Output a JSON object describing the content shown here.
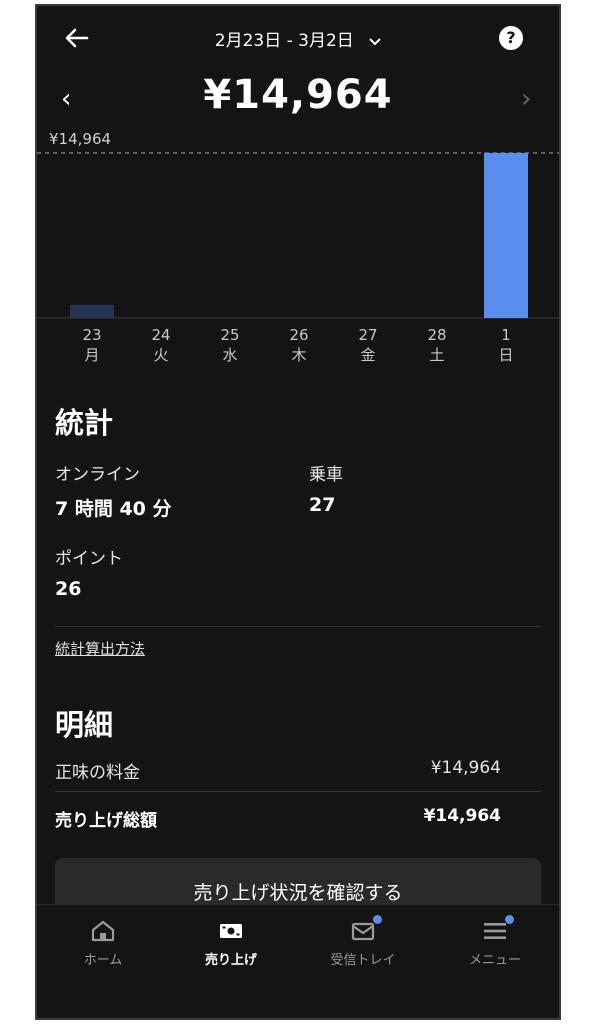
{
  "header": {
    "date_range": "2月23日 - 3月2日",
    "total": "¥14,964"
  },
  "chart_data": {
    "type": "bar",
    "categories": [
      "23 月",
      "24 火",
      "25 水",
      "26 木",
      "27 金",
      "28 土",
      "1 日"
    ],
    "day_numbers": [
      "23",
      "24",
      "25",
      "26",
      "27",
      "28",
      "1"
    ],
    "weekdays": [
      "月",
      "火",
      "水",
      "木",
      "金",
      "土",
      "日"
    ],
    "values": [
      1200,
      0,
      0,
      0,
      0,
      0,
      14964
    ],
    "max_label": "¥14,964",
    "ylim": [
      0,
      14964
    ],
    "colors": {
      "active": "#5b8def",
      "inactive": "#263552",
      "reference_line": "#8a8a8a"
    }
  },
  "stats": {
    "title": "統計",
    "online_label": "オンライン",
    "online_value": "7 時間 40 分",
    "rides_label": "乗車",
    "rides_value": "27",
    "points_label": "ポイント",
    "points_value": "26",
    "method_link": "統計算出方法"
  },
  "details": {
    "title": "明細",
    "net_fare_label": "正味の料金",
    "net_fare_value": "¥14,964",
    "total_sales_label": "売り上げ総額",
    "total_sales_value": "¥14,964",
    "cta_label": "売り上げ状況を確認する"
  },
  "nav": {
    "items": [
      {
        "label": "ホーム",
        "icon": "home-icon"
      },
      {
        "label": "売り上げ",
        "icon": "cash-icon"
      },
      {
        "label": "受信トレイ",
        "icon": "inbox-icon"
      },
      {
        "label": "メニュー",
        "icon": "menu-icon"
      }
    ],
    "accent": "#5b8def"
  }
}
